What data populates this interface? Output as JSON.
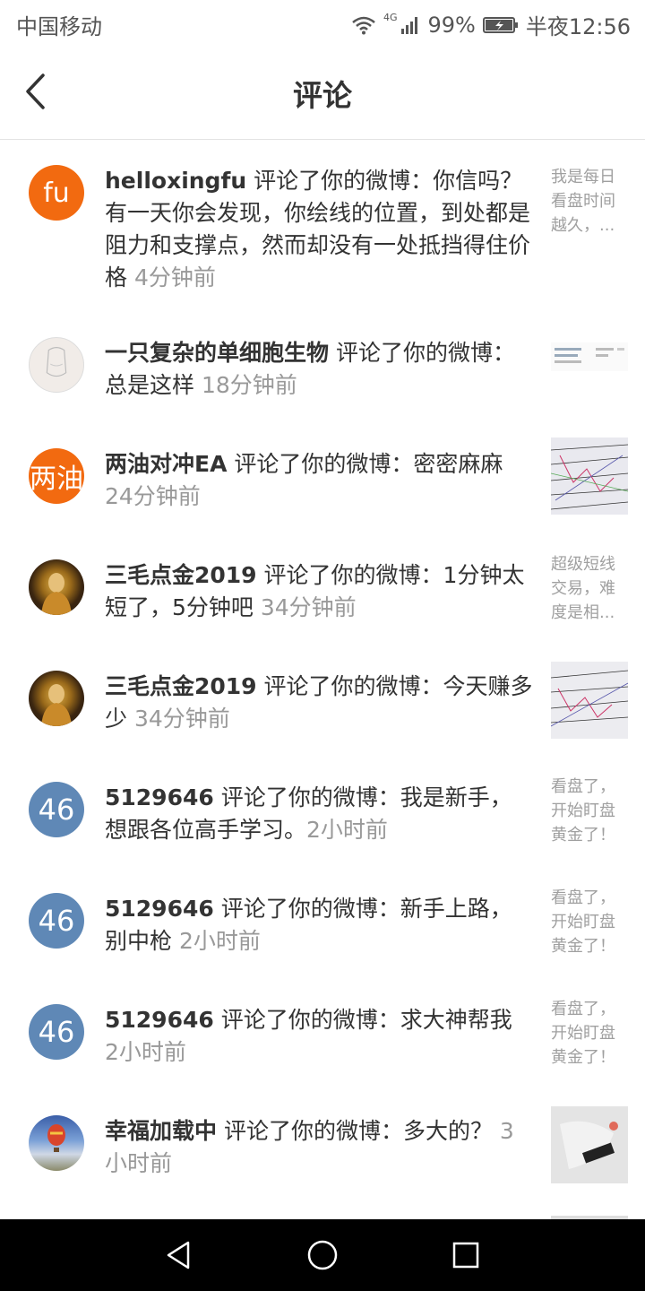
{
  "status_bar": {
    "carrier": "中国移动",
    "network": "4G",
    "battery": "99%",
    "time": "半夜12:56"
  },
  "header": {
    "title": "评论",
    "back_icon": "chevron-left-icon"
  },
  "comments": [
    {
      "user": "helloxingfu",
      "avatar_text": "fu",
      "text": " 评论了你的微博：你信吗？有一天你会发现，你绘线的位置，到处都是阻力和支撑点，然而却没有一处抵挡得住价格 ",
      "time": "4分钟前",
      "preview": "我是每日看盘时间越久，..."
    },
    {
      "user": "一只复杂的单细胞生物",
      "avatar_text": "",
      "text": " 评论了你的微博：总是这样 ",
      "time": "18分钟前",
      "preview": ""
    },
    {
      "user": "两油对冲EA",
      "avatar_text": "两油",
      "text": " 评论了你的微博：密密麻麻 ",
      "time": "24分钟前",
      "preview": ""
    },
    {
      "user": "三毛点金2019",
      "avatar_text": "",
      "text": " 评论了你的微博：1分钟太短了，5分钟吧 ",
      "time": "34分钟前",
      "preview": "超级短线交易，难度是相..."
    },
    {
      "user": "三毛点金2019",
      "avatar_text": "",
      "text": " 评论了你的微博：今天赚多少 ",
      "time": "34分钟前",
      "preview": ""
    },
    {
      "user": "5129646",
      "avatar_text": "46",
      "text": " 评论了你的微博：我是新手，想跟各位高手学习。",
      "time": "2小时前",
      "preview": "看盘了，开始盯盘黄金了！"
    },
    {
      "user": "5129646",
      "avatar_text": "46",
      "text": " 评论了你的微博：新手上路，别中枪 ",
      "time": "2小时前",
      "preview": "看盘了，开始盯盘黄金了！"
    },
    {
      "user": "5129646",
      "avatar_text": "46",
      "text": " 评论了你的微博：求大神帮我 ",
      "time": "2小时前",
      "preview": "看盘了，开始盯盘黄金了！"
    },
    {
      "user": "幸福加载中",
      "avatar_text": "",
      "text": " 评论了你的微博：多大的？ ",
      "time": "3小时前",
      "preview": ""
    }
  ],
  "nav": {
    "back": "triangle-back-icon",
    "home": "circle-home-icon",
    "recent": "square-recent-icon"
  }
}
